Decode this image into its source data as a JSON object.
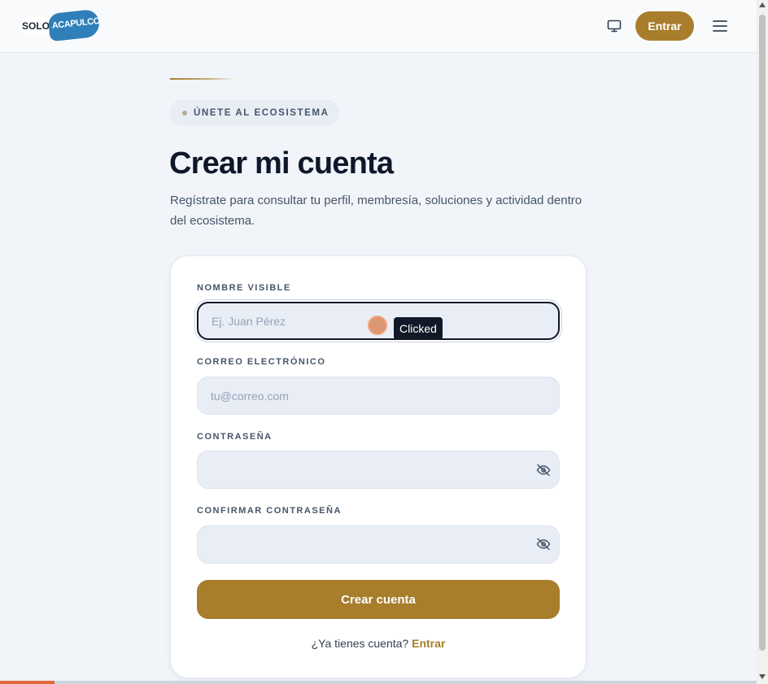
{
  "header": {
    "logo_solo": "SOLO",
    "logo_brand": "ACAPULCO!",
    "display_icon": "monitor-icon",
    "enter_label": "Entrar",
    "menu_icon": "hamburger-menu-icon"
  },
  "hero": {
    "badge": "ÚNETE AL ECOSISTEMA",
    "title": "Crear mi cuenta",
    "subtitle": "Regístrate para consultar tu perfil, membresía, soluciones y actividad dentro del ecosistema."
  },
  "form": {
    "name_label": "NOMBRE VISIBLE",
    "name_placeholder": "Ej. Juan Pérez",
    "name_value": "",
    "email_label": "CORREO ELECTRÓNICO",
    "email_placeholder": "tu@correo.com",
    "email_value": "",
    "password_label": "CONTRASEÑA",
    "password_value": "",
    "confirm_label": "CONFIRMAR CONTRASEÑA",
    "confirm_value": "",
    "toggle_icon": "eye-off-icon",
    "submit_label": "Crear cuenta",
    "login_prompt": "¿Ya tienes cuenta?",
    "login_link": "Entrar"
  },
  "overlay": {
    "click_tooltip": "Clicked"
  },
  "colors": {
    "accent": "#a87d2c",
    "text_dark": "#0f172a",
    "background": "#f1f5f9"
  }
}
